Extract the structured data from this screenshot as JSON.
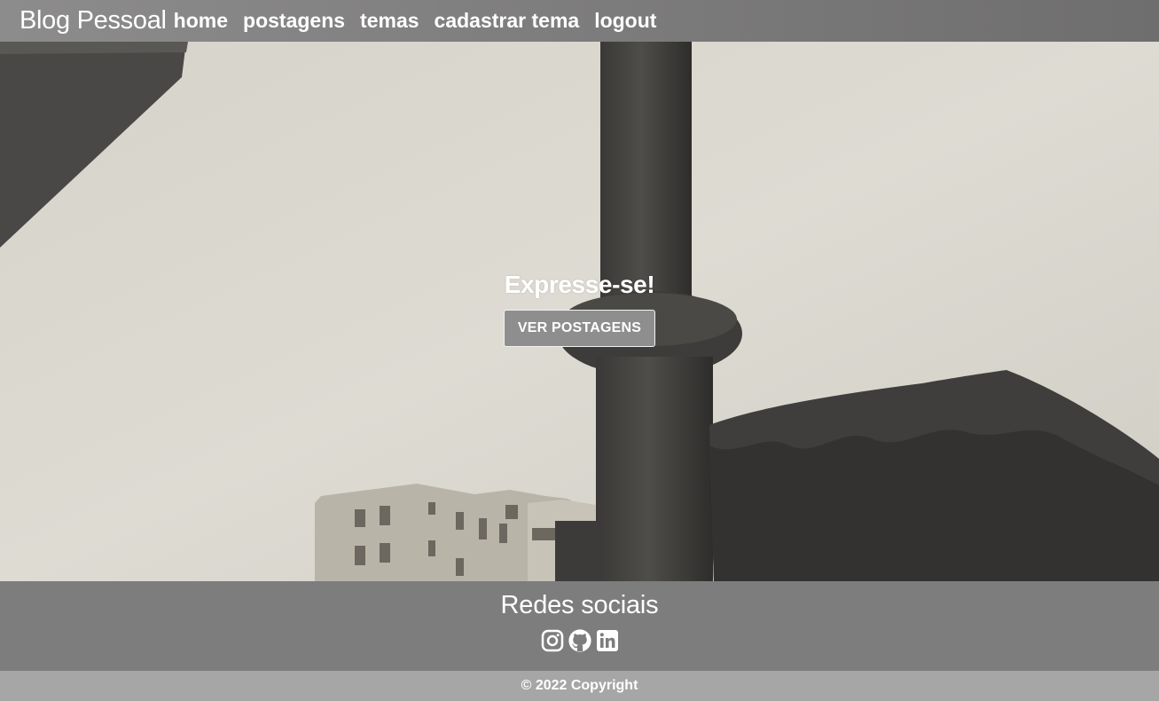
{
  "navbar": {
    "brand": "Blog Pessoal",
    "links": [
      {
        "label": "home"
      },
      {
        "label": "postagens"
      },
      {
        "label": "temas"
      },
      {
        "label": "cadastrar tema"
      },
      {
        "label": "logout"
      }
    ]
  },
  "hero": {
    "title": "Expresse-se!",
    "button_label": "VER POSTAGENS"
  },
  "social": {
    "title": "Redes sociais",
    "icons": [
      "instagram-icon",
      "github-icon",
      "linkedin-icon"
    ]
  },
  "footer": {
    "copyright": "© 2022 Copyright"
  },
  "colors": {
    "navbar": "#7c7b7b",
    "social_bg": "#7d7d7d",
    "copyright_bg": "#a6a6a6",
    "button_bg": "#8e8e8e",
    "text": "#ffffff"
  }
}
